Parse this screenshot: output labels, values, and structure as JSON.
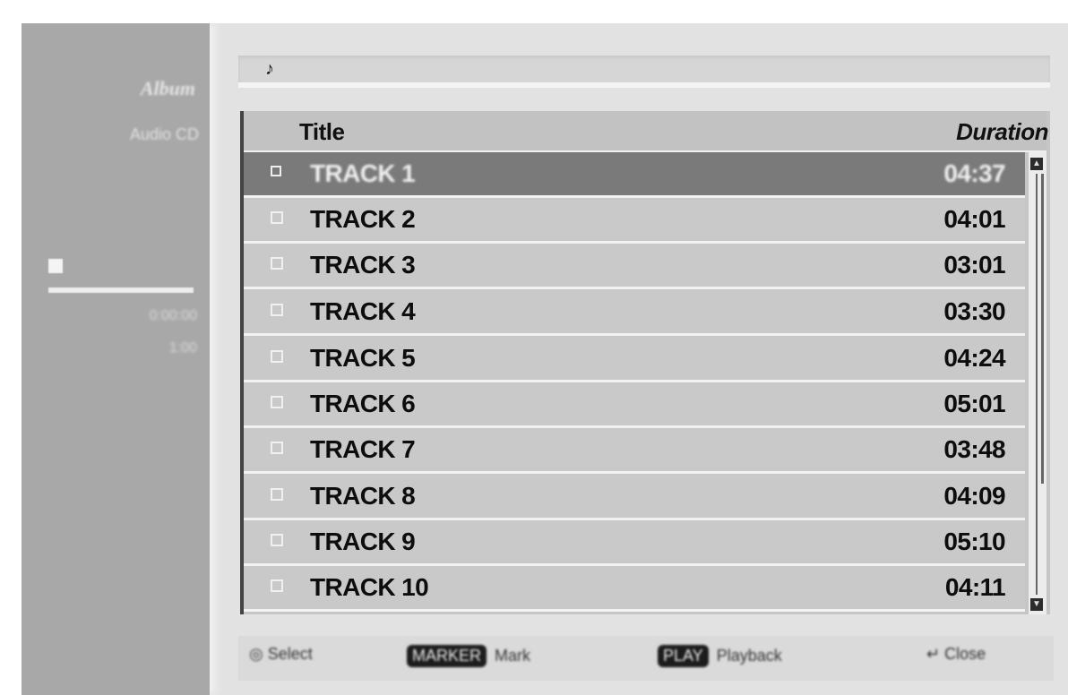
{
  "left_panel": {
    "title": "Album",
    "subtitle": "Audio CD",
    "info_line_1": "0:00:00",
    "info_line_2": "1:00"
  },
  "path_bar": {
    "icon": "music-note-icon"
  },
  "list": {
    "header": {
      "title": "Title",
      "duration": "Duration"
    },
    "rows": [
      {
        "title": "TRACK 1",
        "duration": "04:37",
        "selected": true
      },
      {
        "title": "TRACK 2",
        "duration": "04:01"
      },
      {
        "title": "TRACK 3",
        "duration": "03:01"
      },
      {
        "title": "TRACK 4",
        "duration": "03:30"
      },
      {
        "title": "TRACK 5",
        "duration": "04:24"
      },
      {
        "title": "TRACK 6",
        "duration": "05:01"
      },
      {
        "title": "TRACK 7",
        "duration": "03:48"
      },
      {
        "title": "TRACK 8",
        "duration": "04:09"
      },
      {
        "title": "TRACK 9",
        "duration": "05:10"
      },
      {
        "title": "TRACK 10",
        "duration": "04:11"
      }
    ]
  },
  "bottom_bar": {
    "select_label": "Select",
    "mark_key": "MARKER",
    "mark_label": "Mark",
    "play_key": "PLAY",
    "play_label": "Playback",
    "return_label": "Close"
  },
  "colors": {
    "panel": "#a8a8a8",
    "list_row": "#c9c9c9",
    "selected_row": "#7a7a7a"
  }
}
